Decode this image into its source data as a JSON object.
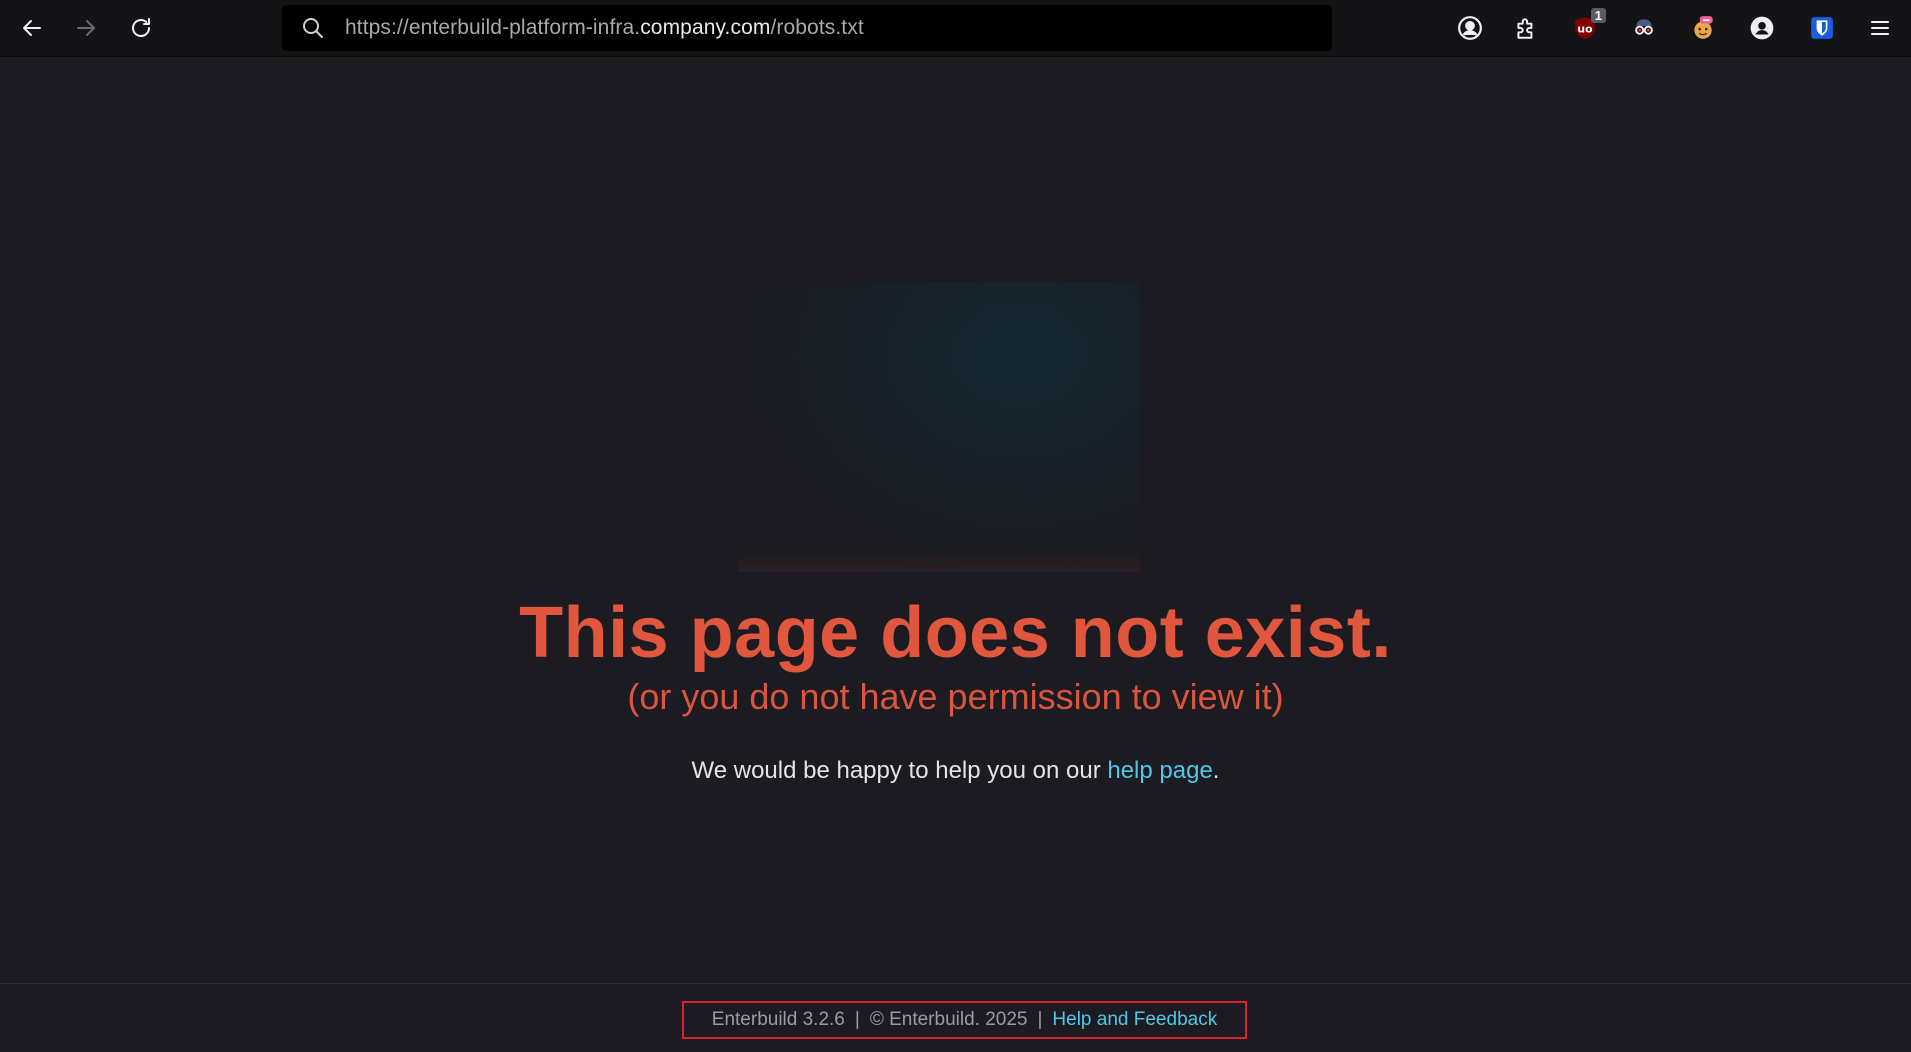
{
  "browser": {
    "url": {
      "prefix": "https://enterbuild-platform-infra.",
      "host": "company.com",
      "path": "/robots.txt"
    },
    "extensions": [
      {
        "name": "account-icon"
      },
      {
        "name": "extensions-puzzle-icon"
      },
      {
        "name": "ublock-origin-icon",
        "badge": "1"
      },
      {
        "name": "privacy-glasses-icon"
      },
      {
        "name": "emoji-extension-icon"
      },
      {
        "name": "profile-icon"
      },
      {
        "name": "bitwarden-icon"
      }
    ]
  },
  "page": {
    "headline": "This page does not exist.",
    "subline": "(or you do not have permission to view it)",
    "help_prefix": "We would be happy to help you on our ",
    "help_link": "help page",
    "help_suffix": "."
  },
  "footer": {
    "version": "Enterbuild 3.2.6",
    "separator": "|",
    "copyright": "© Enterbuild. 2025",
    "feedback_link": "Help and Feedback"
  },
  "colors": {
    "headline": "#e0573e",
    "link": "#4fc8e8",
    "background": "#1c1b22",
    "highlight_box": "#d8232a"
  }
}
